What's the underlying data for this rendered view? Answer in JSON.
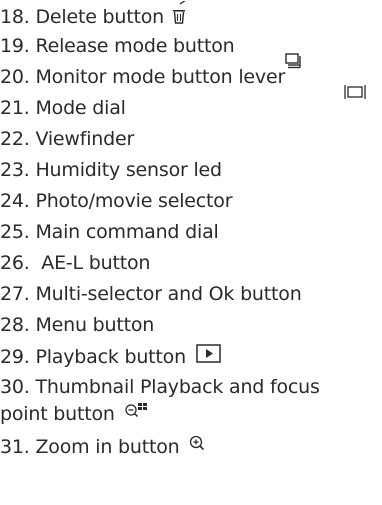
{
  "items": [
    {
      "label": "18. Delete button",
      "icon": "trash-icon"
    },
    {
      "label": "19. Release mode button",
      "icon": "release-mode-icon"
    },
    {
      "label": "20. Monitor mode button lever",
      "icon": "monitor-mode-icon"
    },
    {
      "label": "21. Mode dial",
      "icon": ""
    },
    {
      "label": "22. Viewfinder",
      "icon": ""
    },
    {
      "label": "23. Humidity sensor led",
      "icon": ""
    },
    {
      "label": "24. Photo/movie selector",
      "icon": ""
    },
    {
      "label": "25. Main command dial",
      "icon": ""
    },
    {
      "label": "26.  AE-L button",
      "icon": ""
    },
    {
      "label": "27. Multi-selector and Ok button",
      "icon": ""
    },
    {
      "label": "28. Menu button",
      "icon": ""
    },
    {
      "label": "29. Playback button",
      "icon": "play-box-icon"
    },
    {
      "label": "30. Thumbnail Playback and focus",
      "icon": ""
    },
    {
      "label": "point button",
      "icon": "zoom-out-focus-icon"
    },
    {
      "label": "31. Zoom in button",
      "icon": "zoom-in-icon"
    }
  ]
}
